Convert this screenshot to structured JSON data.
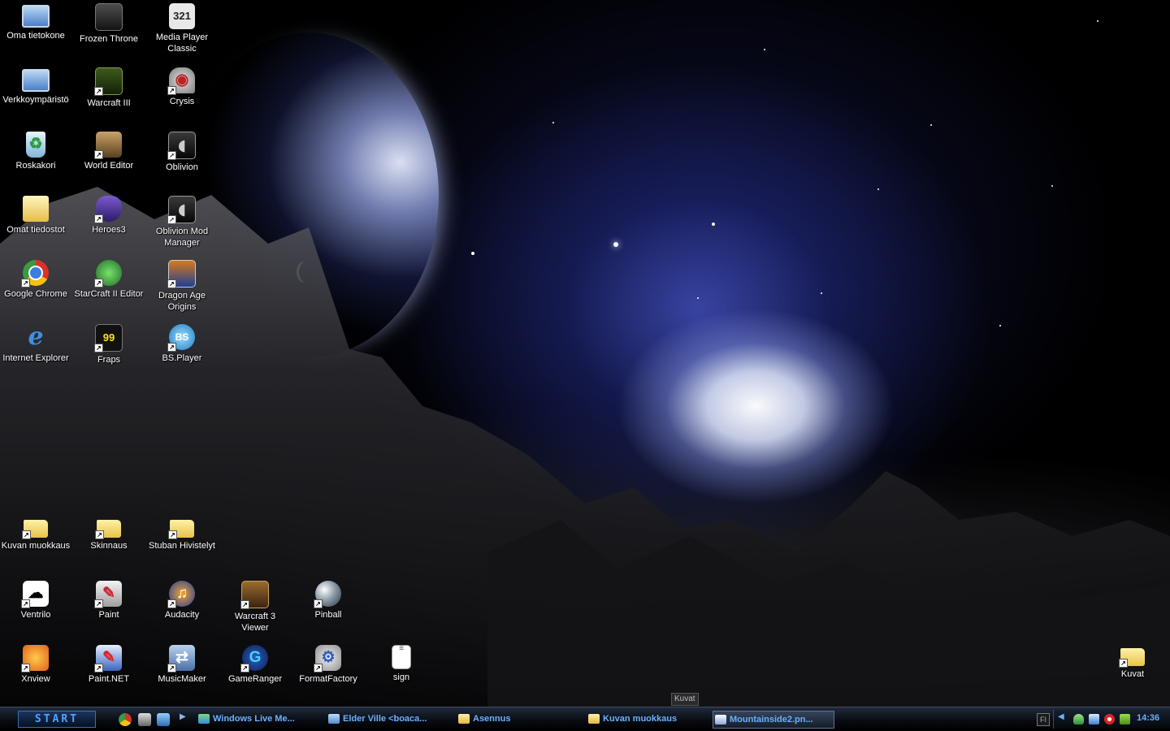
{
  "desktop": {
    "icons_left": [
      {
        "label": "Oma tietokone",
        "icon": "my-computer-icon",
        "shortcut": false
      },
      {
        "label": "Frozen Throne",
        "icon": "frozen-throne-icon",
        "shortcut": false
      },
      {
        "label": "Media Player\nClassic",
        "icon": "media-player-classic-icon",
        "shortcut": false
      },
      {
        "label": "Verkkoympäristö",
        "icon": "network-places-icon",
        "shortcut": false
      },
      {
        "label": "Warcraft III",
        "icon": "warcraft-iii-icon",
        "shortcut": true
      },
      {
        "label": "Crysis",
        "icon": "crysis-icon",
        "shortcut": true
      },
      {
        "label": "Roskakori",
        "icon": "recycle-bin-icon",
        "shortcut": false
      },
      {
        "label": "World Editor",
        "icon": "world-editor-icon",
        "shortcut": true
      },
      {
        "label": "Oblivion",
        "icon": "oblivion-icon",
        "shortcut": true
      },
      {
        "label": "Omat tiedostot",
        "icon": "my-documents-icon",
        "shortcut": false
      },
      {
        "label": "Heroes3",
        "icon": "heroes3-icon",
        "shortcut": true
      },
      {
        "label": "Oblivion Mod\nManager",
        "icon": "oblivion-mod-manager-icon",
        "shortcut": true
      },
      {
        "label": "Google Chrome",
        "icon": "google-chrome-icon",
        "shortcut": true
      },
      {
        "label": "StarCraft II Editor",
        "icon": "starcraft-ii-editor-icon",
        "shortcut": true
      },
      {
        "label": "Dragon Age\nOrigins",
        "icon": "dragon-age-origins-icon",
        "shortcut": true
      },
      {
        "label": "Internet Explorer",
        "icon": "internet-explorer-icon",
        "shortcut": false
      },
      {
        "label": "Fraps",
        "icon": "fraps-icon",
        "shortcut": true
      },
      {
        "label": "BS.Player",
        "icon": "bs-player-icon",
        "shortcut": true
      }
    ],
    "icons_bottom": [
      {
        "label": "Kuvan muokkaus",
        "icon": "folder-icon",
        "shortcut": true
      },
      {
        "label": "Skinnaus",
        "icon": "folder-icon",
        "shortcut": true
      },
      {
        "label": "Stuban Hivistelyt",
        "icon": "folder-icon",
        "shortcut": true
      },
      {
        "label": "Ventrilo",
        "icon": "ventrilo-icon",
        "shortcut": true
      },
      {
        "label": "Paint",
        "icon": "paint-icon",
        "shortcut": true
      },
      {
        "label": "Audacity",
        "icon": "audacity-icon",
        "shortcut": true
      },
      {
        "label": "Warcraft 3\nViewer",
        "icon": "warcraft-3-viewer-icon",
        "shortcut": true
      },
      {
        "label": "Pinball",
        "icon": "pinball-icon",
        "shortcut": true
      },
      {
        "label": "Xnview",
        "icon": "xnview-icon",
        "shortcut": true
      },
      {
        "label": "Paint.NET",
        "icon": "paint-net-icon",
        "shortcut": true
      },
      {
        "label": "MusicMaker",
        "icon": "musicmaker-icon",
        "shortcut": true
      },
      {
        "label": "GameRanger",
        "icon": "gameranger-icon",
        "shortcut": true
      },
      {
        "label": "FormatFactory",
        "icon": "format-factory-icon",
        "shortcut": true
      },
      {
        "label": "sign",
        "icon": "text-file-icon",
        "shortcut": false
      }
    ],
    "kuvat_icon": {
      "label": "Kuvat",
      "icon": "folder-icon",
      "shortcut": true
    },
    "tooltip": "Kuvat"
  },
  "taskbar": {
    "start_label": "START",
    "quick_launch": [
      "chrome-icon",
      "game-icon",
      "network-icon"
    ],
    "tasks": [
      {
        "label": "Windows Live Me...",
        "icon": "messenger-icon",
        "active": false
      },
      {
        "label": "Elder Ville <boaca...",
        "icon": "chat-icon",
        "active": false
      },
      {
        "label": "Asennus",
        "icon": "folder-icon",
        "active": false
      },
      {
        "label": "Kuvan muokkaus",
        "icon": "folder-icon",
        "active": false
      },
      {
        "label": "Mountainside2.pn...",
        "icon": "image-viewer-icon",
        "active": true
      }
    ],
    "language": "FI",
    "tray_icons": [
      "users-icon",
      "network-icon",
      "security-icon",
      "nvidia-icon"
    ],
    "clock": "14:36"
  },
  "colors": {
    "taskbar_text": "#6cb0ff",
    "start_text": "#4fa3ff",
    "icon_label": "#ffffff"
  }
}
